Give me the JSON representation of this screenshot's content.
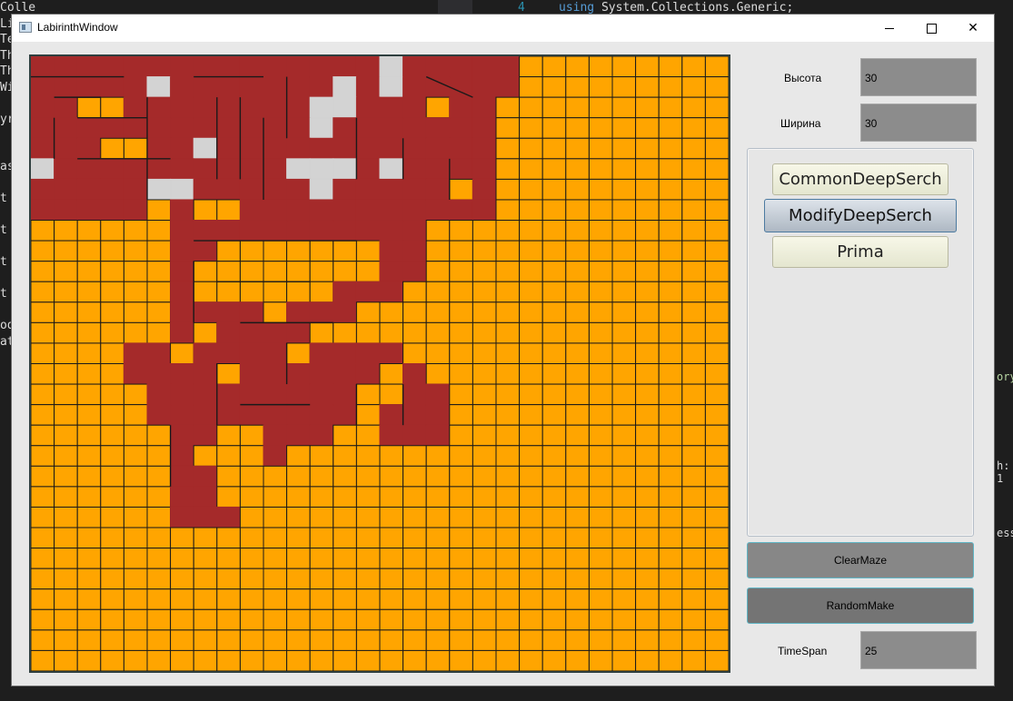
{
  "background": {
    "left_code": [
      "Collections.Generic;",
      "Li",
      "Te",
      "Th",
      "Th",
      "Wi",
      "",
      "yr",
      "",
      "",
      "as",
      "",
      "t",
      "",
      "t",
      "",
      "t",
      "",
      "t",
      "",
      "od",
      "at"
    ],
    "line_number": "4",
    "using_keyword": "using",
    "using_rest": " System.Collections.Generic;",
    "right_frag_1": "ory",
    "right_frag_2": "h: 1",
    "right_frag_3": "essi"
  },
  "window": {
    "title": "LabirinthWindow",
    "close_glyph": "✕"
  },
  "maze": {
    "grid_cols": 30,
    "grid_rows": 30,
    "colors": {
      "empty": "#ffa500",
      "path": "#a52a2a",
      "visited": "#d3d3d3",
      "border": "#1a1a1a"
    }
  },
  "controls": {
    "height_label": "Высота",
    "height_value": "30",
    "width_label": "Ширина",
    "width_value": "30",
    "algorithms": [
      {
        "label": "CommonDeepSerch",
        "active": false
      },
      {
        "label": "ModifyDeepSerch",
        "active": true
      },
      {
        "label": "Prima",
        "active": false
      }
    ],
    "clear_label": "ClearMaze",
    "random_label": "RandomMake",
    "timespan_label": "TimeSpan",
    "timespan_value": "25"
  }
}
